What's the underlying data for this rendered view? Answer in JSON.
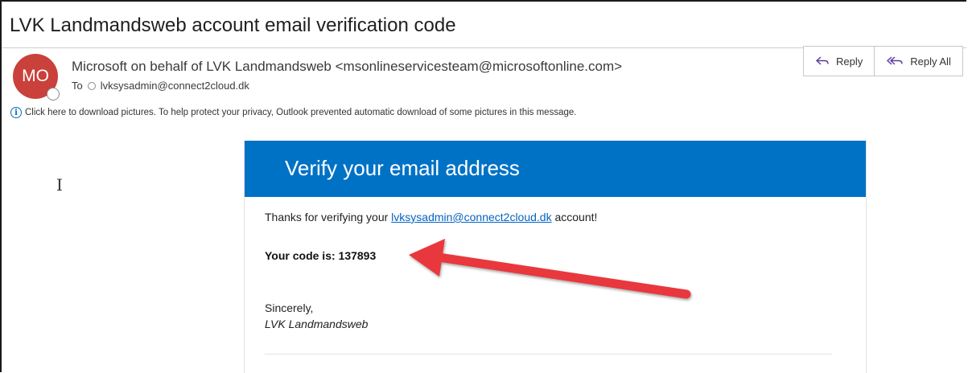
{
  "email": {
    "subject": "LVK Landmandsweb account email verification code",
    "avatar_initials": "MO",
    "sender": "Microsoft on behalf of LVK Landmandsweb <msonlineservicesteam@microsoftonline.com>",
    "to_label": "To",
    "to_address": "lvksysadmin@connect2cloud.dk",
    "info_bar_text": "Click here to download pictures. To help protect your privacy, Outlook prevented automatic download of some pictures in this message."
  },
  "actions": {
    "reply_label": "Reply",
    "reply_all_label": "Reply All"
  },
  "message": {
    "banner_title": "Verify your email address",
    "thanks_prefix": "Thanks for verifying your ",
    "thanks_link": "lvksysadmin@connect2cloud.dk",
    "thanks_suffix": " account!",
    "code_text": "Your code is: 137893",
    "closing": "Sincerely,",
    "signature": "LVK Landmandsweb"
  },
  "colors": {
    "banner": "#0072c6",
    "avatar": "#c9413a",
    "annotation_arrow": "#e8383d",
    "link": "#0563c1"
  },
  "icons": [
    "reply-icon",
    "reply-all-icon",
    "info-icon",
    "presence-icon",
    "text-cursor-icon",
    "annotation-arrow"
  ]
}
